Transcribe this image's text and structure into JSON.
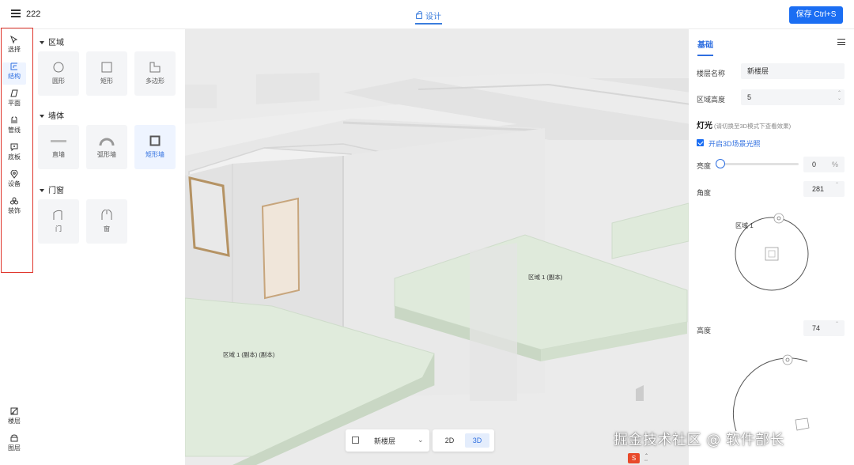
{
  "header": {
    "project_name": "222",
    "design_tab": "设计",
    "save_label": "保存 Ctrl+S"
  },
  "left_rail": {
    "items": [
      {
        "label": "选择",
        "icon": "cursor-icon"
      },
      {
        "label": "结构",
        "icon": "structure-icon",
        "active": true
      },
      {
        "label": "平面",
        "icon": "plane-icon"
      },
      {
        "label": "管线",
        "icon": "pipeline-icon"
      },
      {
        "label": "底板",
        "icon": "baseboard-icon"
      },
      {
        "label": "设备",
        "icon": "device-icon"
      },
      {
        "label": "装饰",
        "icon": "decoration-icon"
      }
    ],
    "bottom_items": [
      {
        "label": "楼层",
        "icon": "floor-icon"
      },
      {
        "label": "图层",
        "icon": "layer-icon"
      }
    ],
    "highlight_color": "#e0352b"
  },
  "palette": {
    "sections": [
      {
        "title": "区域",
        "tiles": [
          "圆形",
          "矩形",
          "多边形"
        ]
      },
      {
        "title": "墙体",
        "tiles": [
          "直墙",
          "弧形墙",
          "矩形墙"
        ]
      },
      {
        "title": "门窗",
        "tiles": [
          "门",
          "窗"
        ]
      }
    ],
    "selected_tile": "矩形墙"
  },
  "viewport": {
    "labels": {
      "region_copy": "区域 1 (副本)",
      "region_copy_copy": "区域 1 (副本) (副本)"
    },
    "floor_select": "新楼层",
    "modes": [
      "2D",
      "3D"
    ],
    "active_mode": "3D"
  },
  "right_panel": {
    "tab": "基础",
    "floor_name_label": "楼层名称",
    "floor_name_value": "新楼层",
    "region_height_label": "区域高度",
    "region_height_value": "5",
    "light_heading": "灯光",
    "light_hint": "(请切换至3D模式下查看效果)",
    "enable_3d_light": "开启3D场景光照",
    "brightness_label": "亮度",
    "brightness_value": "0",
    "brightness_unit": "%",
    "angle_label": "角度",
    "angle_value": "281",
    "dial_region_label": "区域 1",
    "altitude_label": "高度",
    "altitude_value": "74"
  },
  "watermark": "掘金技术社区 @ 软件部长",
  "accent_color": "#1b6ef3"
}
